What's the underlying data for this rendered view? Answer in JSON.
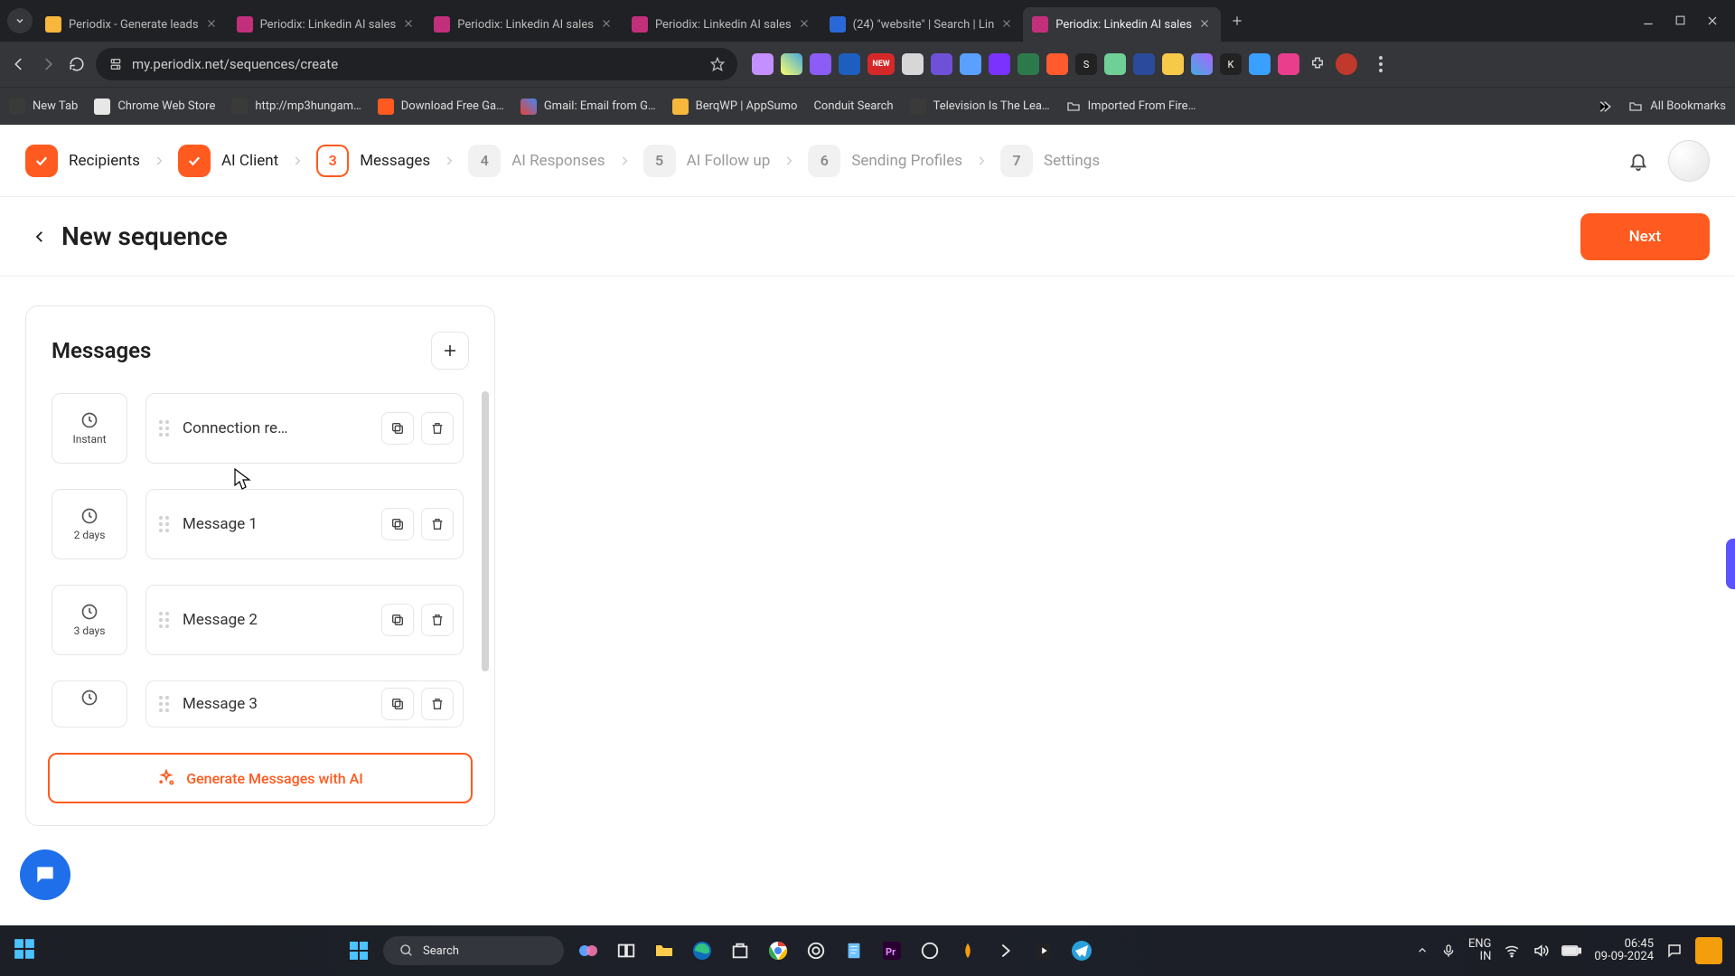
{
  "browser": {
    "tabs": [
      {
        "title": "Periodix - Generate leads",
        "favicon": "fav-yellow",
        "active": false
      },
      {
        "title": "Periodix: Linkedin AI sales",
        "favicon": "fav-mag",
        "active": false
      },
      {
        "title": "Periodix: Linkedin AI sales",
        "favicon": "fav-mag",
        "active": false
      },
      {
        "title": "Periodix: Linkedin AI sales",
        "favicon": "fav-mag",
        "active": false
      },
      {
        "title": "(24) \"website\" | Search | Lin",
        "favicon": "fav-blue",
        "active": false
      },
      {
        "title": "Periodix: Linkedin AI sales",
        "favicon": "fav-mag",
        "active": true
      }
    ],
    "url": "my.periodix.net/sequences/create"
  },
  "bookmarks": {
    "items": [
      {
        "label": "New Tab",
        "fav": "fav-dark"
      },
      {
        "label": "Chrome Web Store",
        "fav": "fav-white"
      },
      {
        "label": "http://mp3hungam…",
        "fav": "fav-dark"
      },
      {
        "label": "Download Free Ga…",
        "fav": "fav-orange"
      },
      {
        "label": "Gmail: Email from G…",
        "fav": "fav-red"
      },
      {
        "label": "BerqWP | AppSumo",
        "fav": "fav-yellow"
      },
      {
        "label": "Conduit Search",
        "fav": ""
      },
      {
        "label": "Television Is The Lea…",
        "fav": "fav-dark"
      },
      {
        "label": "Imported From Fire…",
        "fav": ""
      }
    ],
    "all_label": "All Bookmarks"
  },
  "stepper": {
    "items": [
      {
        "state": "done",
        "num": "",
        "label": "Recipients"
      },
      {
        "state": "done",
        "num": "",
        "label": "AI Client"
      },
      {
        "state": "active",
        "num": "3",
        "label": "Messages"
      },
      {
        "state": "todo",
        "num": "4",
        "label": "AI Responses"
      },
      {
        "state": "todo",
        "num": "5",
        "label": "AI Follow up"
      },
      {
        "state": "todo",
        "num": "6",
        "label": "Sending Profiles"
      },
      {
        "state": "todo",
        "num": "7",
        "label": "Settings"
      }
    ]
  },
  "header": {
    "title": "New sequence",
    "next_label": "Next"
  },
  "panel": {
    "title": "Messages",
    "generate_label": "Generate Messages with AI",
    "items": [
      {
        "delay": "Instant",
        "title": "Connection re…"
      },
      {
        "delay": "2 days",
        "title": "Message 1"
      },
      {
        "delay": "3 days",
        "title": "Message 2"
      },
      {
        "delay": "",
        "title": "Message 3"
      }
    ]
  },
  "taskbar": {
    "search_placeholder": "Search",
    "lang_top": "ENG",
    "lang_bottom": "IN",
    "time": "06:45",
    "date": "09-09-2024"
  },
  "colors": {
    "accent": "#ff5a1f",
    "chat": "#1f6feb",
    "side_handle": "#5b53ff"
  }
}
